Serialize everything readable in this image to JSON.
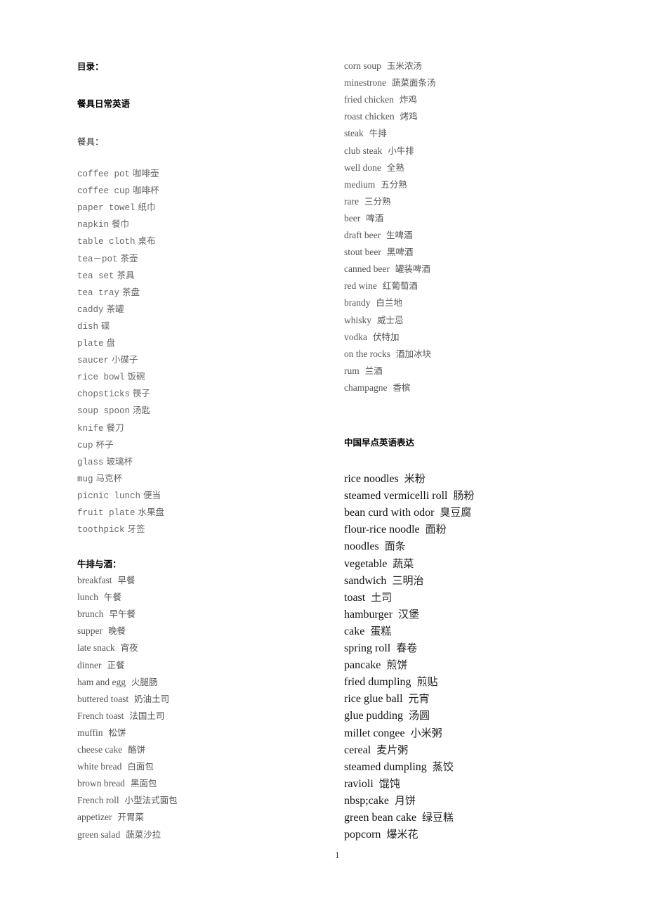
{
  "toc_label": "目录：",
  "title": "餐具日常英语",
  "tableware": {
    "heading": "餐具：",
    "items": [
      {
        "en": "coffee pot",
        "zh": "咖啡壶"
      },
      {
        "en": "coffee cup",
        "zh": "咖啡杯"
      },
      {
        "en": "paper towel",
        "zh": "纸巾"
      },
      {
        "en": "napkin",
        "zh": "餐巾"
      },
      {
        "en": "table cloth",
        "zh": "桌布"
      },
      {
        "en": "tea－pot",
        "zh": "茶壶"
      },
      {
        "en": "tea set",
        "zh": "茶具"
      },
      {
        "en": "tea tray",
        "zh": "茶盘"
      },
      {
        "en": "caddy",
        "zh": "茶罐"
      },
      {
        "en": "dish",
        "zh": "碟"
      },
      {
        "en": "plate",
        "zh": "盘"
      },
      {
        "en": "saucer",
        "zh": "小碟子"
      },
      {
        "en": "rice bowl",
        "zh": "饭碗"
      },
      {
        "en": "chopsticks",
        "zh": "筷子"
      },
      {
        "en": "soup spoon",
        "zh": "汤匙"
      },
      {
        "en": "knife",
        "zh": "餐刀"
      },
      {
        "en": "cup",
        "zh": "杯子"
      },
      {
        "en": "glass",
        "zh": "玻璃杯"
      },
      {
        "en": "mug",
        "zh": "马克杯"
      },
      {
        "en": "picnic lunch",
        "zh": "便当"
      },
      {
        "en": "fruit plate",
        "zh": "水果盘"
      },
      {
        "en": "toothpick",
        "zh": "牙签"
      }
    ]
  },
  "steak_wine": {
    "heading": "牛排与酒：",
    "items_left": [
      {
        "en": "breakfast",
        "zh": "早餐"
      },
      {
        "en": "lunch",
        "zh": "午餐"
      },
      {
        "en": "brunch",
        "zh": "早午餐"
      },
      {
        "en": "supper",
        "zh": "晚餐"
      },
      {
        "en": "late snack",
        "zh": "宵夜"
      },
      {
        "en": "dinner",
        "zh": "正餐"
      },
      {
        "en": "ham and egg",
        "zh": "火腿肠"
      },
      {
        "en": "buttered toast",
        "zh": "奶油土司"
      },
      {
        "en": "French toast",
        "zh": "法国土司"
      },
      {
        "en": "muffin",
        "zh": "松饼"
      },
      {
        "en": "cheese cake",
        "zh": "酪饼"
      },
      {
        "en": "white bread",
        "zh": "白面包"
      },
      {
        "en": "brown bread",
        "zh": "黑面包"
      },
      {
        "en": "French roll",
        "zh": "小型法式面包"
      },
      {
        "en": "appetizer",
        "zh": "开胃菜"
      },
      {
        "en": "green salad",
        "zh": "蔬菜沙拉"
      }
    ],
    "items_right": [
      {
        "en": "corn soup",
        "zh": "玉米浓汤"
      },
      {
        "en": "minestrone",
        "zh": "蔬菜面条汤"
      },
      {
        "en": "fried chicken",
        "zh": "炸鸡"
      },
      {
        "en": "roast chicken",
        "zh": "烤鸡"
      },
      {
        "en": "steak",
        "zh": "牛排"
      },
      {
        "en": "club steak",
        "zh": "小牛排"
      },
      {
        "en": "well done",
        "zh": "全熟"
      },
      {
        "en": "medium",
        "zh": "五分熟"
      },
      {
        "en": "rare",
        "zh": "三分熟"
      },
      {
        "en": "beer",
        "zh": "啤酒"
      },
      {
        "en": "draft beer",
        "zh": "生啤酒"
      },
      {
        "en": "stout beer",
        "zh": "黑啤酒"
      },
      {
        "en": "canned beer",
        "zh": "罐装啤酒"
      },
      {
        "en": "red wine",
        "zh": "红葡萄酒"
      },
      {
        "en": "brandy",
        "zh": "白兰地"
      },
      {
        "en": "whisky",
        "zh": "威士忌"
      },
      {
        "en": "vodka",
        "zh": "伏特加"
      },
      {
        "en": "on the rocks",
        "zh": "酒加冰块"
      },
      {
        "en": "rum",
        "zh": "兰酒"
      },
      {
        "en": "champagne",
        "zh": "香槟"
      }
    ]
  },
  "breakfast_cn": {
    "heading": "中国早点英语表达",
    "items": [
      {
        "en": "rice noodles",
        "zh": "米粉"
      },
      {
        "en": "steamed vermicelli roll",
        "zh": "肠粉"
      },
      {
        "en": "bean curd with odor",
        "zh": "臭豆腐"
      },
      {
        "en": "flour-rice noodle",
        "zh": "面粉"
      },
      {
        "en": "noodles",
        "zh": "面条"
      },
      {
        "en": "vegetable",
        "zh": "蔬菜"
      },
      {
        "en": "sandwich",
        "zh": "三明治"
      },
      {
        "en": "toast",
        "zh": "土司"
      },
      {
        "en": "hamburger",
        "zh": "汉堡"
      },
      {
        "en": "cake",
        "zh": "蛋糕"
      },
      {
        "en": "spring roll",
        "zh": "春卷"
      },
      {
        "en": "pancake",
        "zh": "煎饼"
      },
      {
        "en": "fried dumpling",
        "zh": "煎贴"
      },
      {
        "en": "rice glue ball",
        "zh": "元宵"
      },
      {
        "en": "glue pudding",
        "zh": "汤圆"
      },
      {
        "en": "millet congee",
        "zh": "小米粥"
      },
      {
        "en": "cereal",
        "zh": "麦片粥"
      },
      {
        "en": "steamed dumpling",
        "zh": "蒸饺"
      },
      {
        "en": "ravioli",
        "zh": "馄饨"
      },
      {
        "en": "nbsp;cake",
        "zh": "月饼"
      },
      {
        "en": "green bean cake",
        "zh": "绿豆糕"
      },
      {
        "en": "popcorn",
        "zh": "爆米花"
      }
    ]
  },
  "page_number": "1"
}
